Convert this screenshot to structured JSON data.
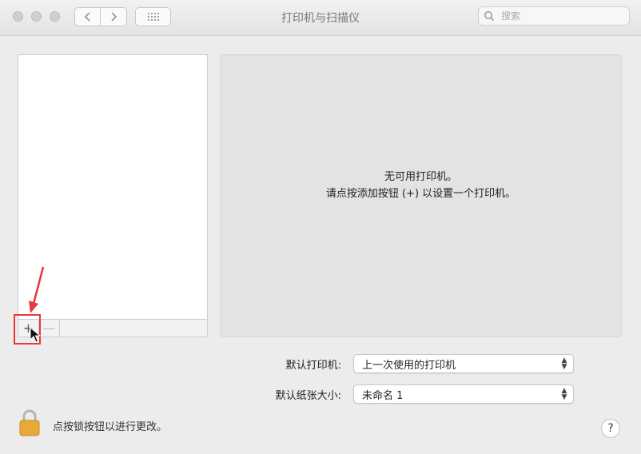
{
  "window": {
    "title": "打印机与扫描仪"
  },
  "toolbar": {
    "back_icon": "chevron-left-icon",
    "forward_icon": "chevron-right-icon",
    "grid_icon": "grid-icon"
  },
  "search": {
    "placeholder": "搜索",
    "value": ""
  },
  "printer_list": {
    "items": [],
    "add_label": "+",
    "remove_label": "—"
  },
  "detail": {
    "line1": "无可用打印机。",
    "line2": "请点按添加按钮 (+) 以设置一个打印机。"
  },
  "settings": {
    "default_printer_label": "默认打印机:",
    "default_printer_value": "上一次使用的打印机",
    "default_paper_label": "默认纸张大小:",
    "default_paper_value": "未命名 1"
  },
  "footer": {
    "lock_text": "点按锁按钮以进行更改。",
    "help_label": "?"
  },
  "colors": {
    "highlight": "#e8383b",
    "lock": "#e8a93b"
  }
}
